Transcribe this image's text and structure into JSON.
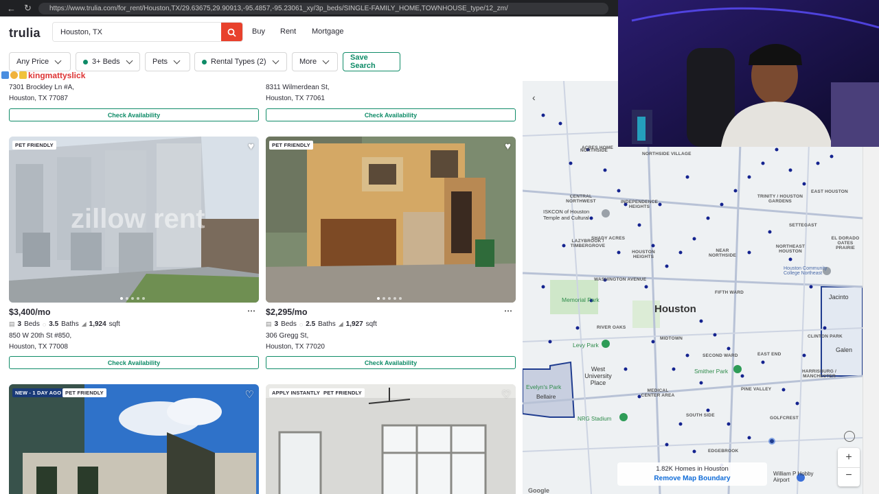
{
  "browser": {
    "url": "https://www.trulia.com/for_rent/Houston,TX/29.63675,29.90913,-95.4857,-95.23061_xy/3p_beds/SINGLE-FAMILY_HOME,TOWNHOUSE_type/12_zm/"
  },
  "header": {
    "logo": "trulia",
    "search_value": "Houston, TX",
    "nav": [
      "Buy",
      "Rent",
      "Mortgage"
    ]
  },
  "filters": {
    "price": "Any Price",
    "beds": "3+ Beds",
    "pets": "Pets",
    "rental_types": "Rental Types (2)",
    "more": "More",
    "save": "Save Search"
  },
  "overlay": {
    "username": "kingmattyslick"
  },
  "top_cards": [
    {
      "addr1": "7301 Brockley Ln #A,",
      "addr2": "Houston, TX 77087",
      "cta": "Check Availability"
    },
    {
      "addr1": "8311 Wilmerdean St,",
      "addr2": "Houston, TX 77061",
      "cta": "Check Availability"
    }
  ],
  "cards": [
    {
      "badges": [
        "PET FRIENDLY"
      ],
      "price": "$3,400/mo",
      "beds": "3",
      "beds_label": "Beds",
      "baths": "3.5",
      "baths_label": "Baths",
      "sqft": "1,924",
      "sqft_label": "sqft",
      "addr1": "850 W 20th St #850,",
      "addr2": "Houston, TX 77008",
      "cta": "Check Availability",
      "watermark": "zillow rent"
    },
    {
      "badges": [
        "PET FRIENDLY"
      ],
      "price": "$2,295/mo",
      "beds": "3",
      "beds_label": "Beds",
      "baths": "2.5",
      "baths_label": "Baths",
      "sqft": "1,927",
      "sqft_label": "sqft",
      "addr1": "306 Gregg St,",
      "addr2": "Houston, TX 77020",
      "cta": "Check Availability"
    }
  ],
  "bottom_cards": [
    {
      "badges": [
        "NEW - 1 DAY AGO",
        "PET FRIENDLY"
      ]
    },
    {
      "badges": [
        "APPLY INSTANTLY",
        "PET FRIENDLY"
      ]
    }
  ],
  "map": {
    "city": "Houston",
    "count_text": "1.82K Homes in Houston",
    "remove_boundary": "Remove Map Boundary",
    "zoom_in": "+",
    "zoom_out": "−",
    "labels": [
      "NORTHSIDE",
      "NORTHSIDE VILLAGE",
      "TRINITY / HOUSTON GARDENS",
      "EAST HOUSTON",
      "CENTRAL NORTHWEST",
      "INDEPENDENCE HEIGHTS",
      "ISKCON of Houston Temple and Cultural",
      "SETTEGAST",
      "EL DORADO OATES PRAIRIE",
      "LAZYBROOK / TIMBERGROVE",
      "SHADY ACRES",
      "HOUSTON HEIGHTS",
      "NEAR NORTHSIDE",
      "NORTHEAST HOUSTON",
      "Houston Community College Northeast",
      "Memorial Park",
      "WASHINGTON AVENUE",
      "FIFTH WARD",
      "Jacinto",
      "RIVER OAKS",
      "MIDTOWN",
      "CLINTON PARK",
      "Levy Park",
      "Smither Park",
      "SECOND WARD",
      "EAST END",
      "Galen",
      "West University Place",
      "Evelyn's Park",
      "Bellaire",
      "MEDICAL CENTER AREA",
      "PINE VALLEY",
      "HARRISBURG / MANCHESTER",
      "NRG Stadium",
      "SOUTH SIDE",
      "GOLFCREST",
      "EDGEBROOK",
      "William P Hobby Airport",
      "ACRES HOME",
      "Google"
    ]
  }
}
